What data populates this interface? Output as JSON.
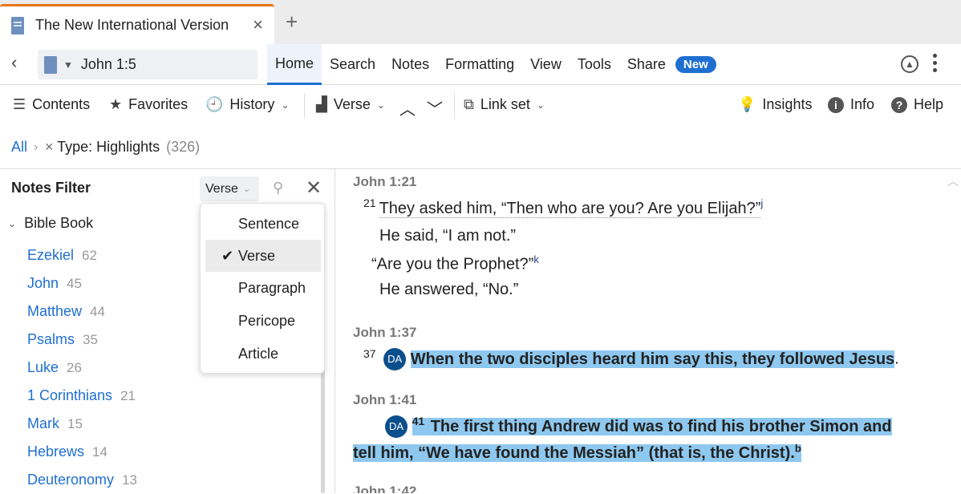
{
  "tab": {
    "title": "The New International Version",
    "close": "×",
    "add": "+"
  },
  "nav": {
    "back": "‹",
    "reference": "John 1:5",
    "menu": [
      "Home",
      "Search",
      "Notes",
      "Formatting",
      "View",
      "Tools",
      "Share"
    ],
    "badge": "New"
  },
  "toolbar": {
    "contents": "Contents",
    "favorites": "Favorites",
    "history": "History",
    "verse": "Verse",
    "linkset": "Link set",
    "insights": "Insights",
    "info": "Info",
    "help": "Help"
  },
  "breadcrumb": {
    "all": "All",
    "filter": "Type: Highlights",
    "count": "(326)"
  },
  "notes_filter": {
    "title": "Notes Filter",
    "selected": "Verse",
    "options": [
      "Sentence",
      "Verse",
      "Paragraph",
      "Pericope",
      "Article"
    ],
    "tree_head": "Bible Book",
    "books": [
      {
        "name": "Ezekiel",
        "count": "62"
      },
      {
        "name": "John",
        "count": "45"
      },
      {
        "name": "Matthew",
        "count": "44"
      },
      {
        "name": "Psalms",
        "count": "35"
      },
      {
        "name": "Luke",
        "count": "26"
      },
      {
        "name": "1 Corinthians",
        "count": "21"
      },
      {
        "name": "Mark",
        "count": "15"
      },
      {
        "name": "Hebrews",
        "count": "14"
      },
      {
        "name": "Deuteronomy",
        "count": "13"
      }
    ]
  },
  "content": {
    "v1_ref": "John 1:21",
    "v1_num": "21",
    "v1_line1": "They asked him, “Then who are you? Are you Elijah?”",
    "v1_fn": "j",
    "v1_line2": "He said, “I am not.”",
    "v1_line3": "“Are you the Prophet?”",
    "v1_fn2": "k",
    "v1_line4": "He answered, “No.”",
    "v2_ref": "John 1:37",
    "v2_num": "37",
    "badge": "DA",
    "v2_text": "When the two disciples heard him say this, they followed Jesus",
    "v2_end": ".",
    "v3_ref": "John 1:41",
    "v3_num": "41",
    "v3_line1": "The first thing Andrew did was to find his brother Simon and",
    "v3_line2": "tell him, “We have found the Messiah” (that is, the Christ).",
    "v3_fn": "b",
    "v4_ref": "John 1:42"
  }
}
